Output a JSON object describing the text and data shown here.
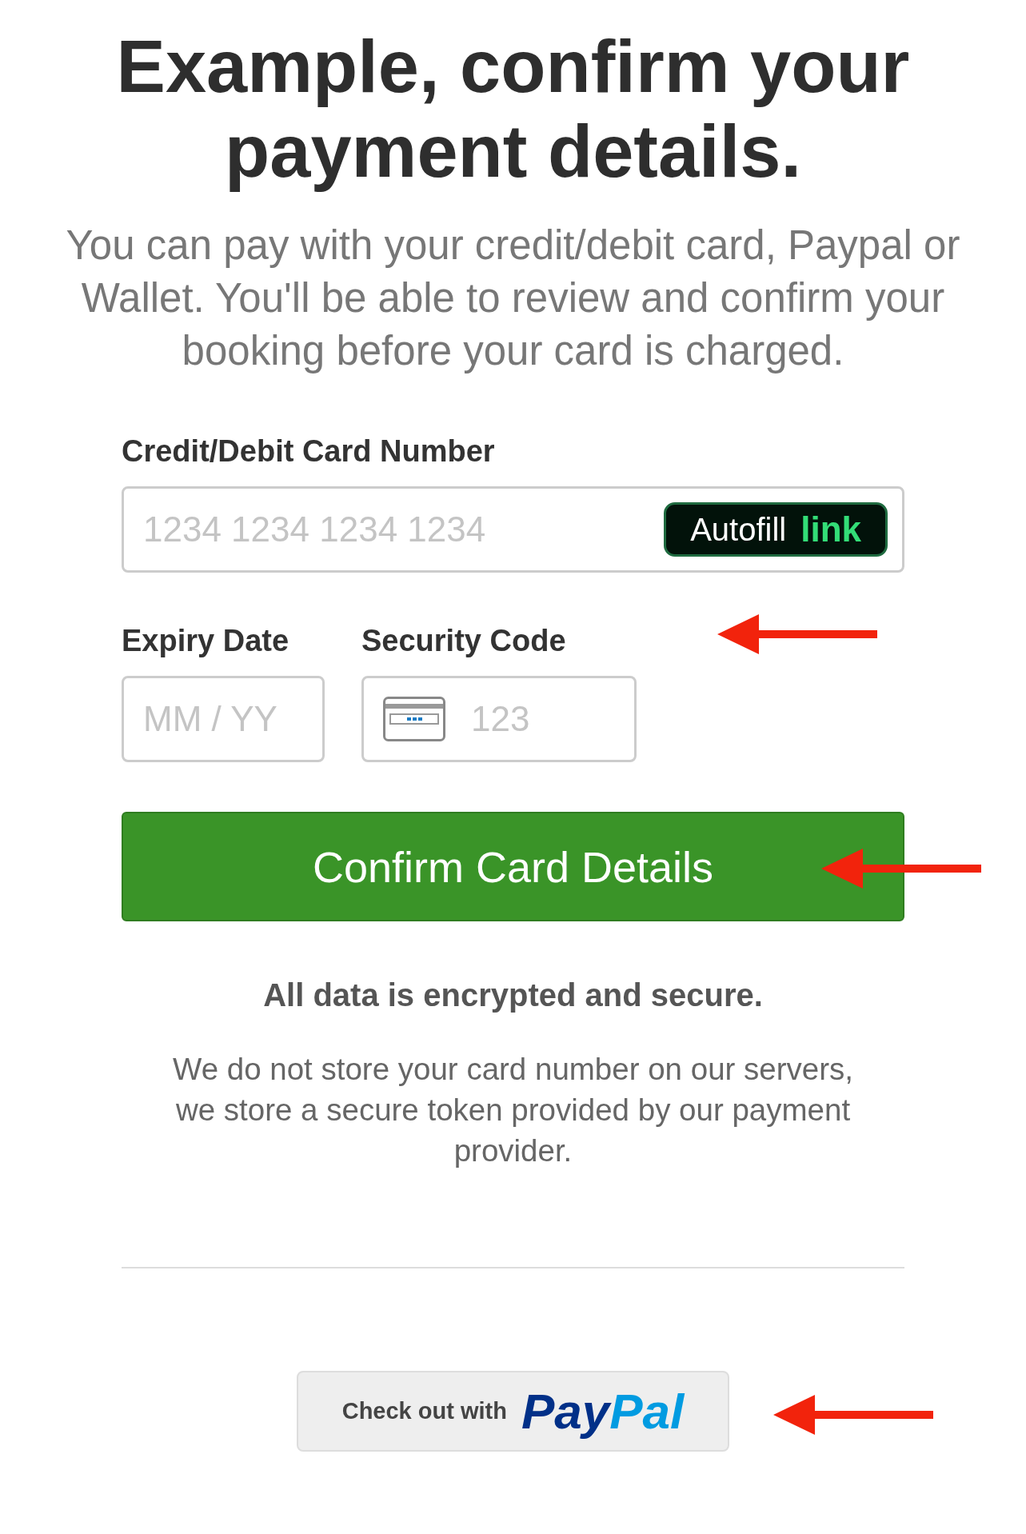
{
  "heading": "Example, confirm your payment details.",
  "intro": "You can pay with your credit/debit card, Paypal or Wallet. You'll be able to review and confirm your booking before your card is charged.",
  "card_number": {
    "label": "Credit/Debit Card Number",
    "placeholder": "1234 1234 1234 1234",
    "autofill": {
      "text": "Autofill",
      "brand": "link"
    }
  },
  "expiry": {
    "label": "Expiry Date",
    "placeholder": "MM / YY"
  },
  "security": {
    "label": "Security Code",
    "placeholder": "123"
  },
  "confirm_button": "Confirm Card Details",
  "secure_note": "All data is encrypted and secure.",
  "storage_note": "We do not store your card number on our servers, we store a secure token provided by our payment provider.",
  "paypal_button": {
    "text": "Check out with",
    "logo_first": "Pay",
    "logo_second": "Pal"
  }
}
